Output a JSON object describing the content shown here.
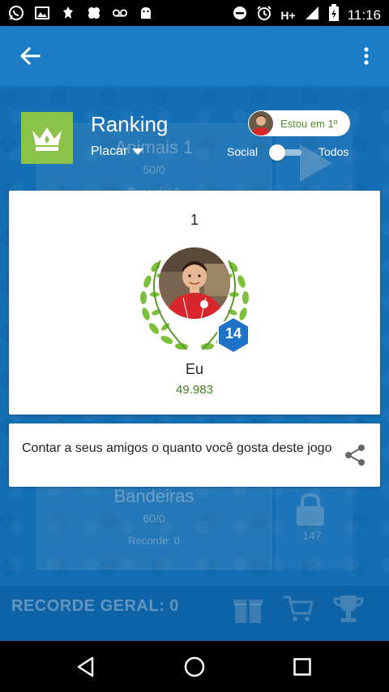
{
  "status_bar": {
    "left_icons": [
      "whatsapp-icon",
      "gallery-icon",
      "app-icon",
      "clover-icon",
      "voicemail-icon",
      "android-icon"
    ],
    "network": "H+",
    "time": "11:16"
  },
  "app_bar": {
    "back_icon": "arrow-back-icon",
    "menu_icon": "more-vert-icon"
  },
  "background": {
    "card1_title": "Animais 1",
    "card1_score": "50/0",
    "card1_record": "Recorde: 0",
    "card2_title": "Bandeiras",
    "card2_score": "60/0",
    "card2_record": "Recorde: 0",
    "locked_count": "147",
    "footer_record": "RECORDE GERAL: 0"
  },
  "header": {
    "title": "Ranking",
    "scope": "Placar",
    "rank_pill": "Estou em 1º",
    "toggle_left": "Social",
    "toggle_right": "Todos"
  },
  "ranking": {
    "position": "1",
    "level": "14",
    "name": "Eu",
    "score": "49.983"
  },
  "share": {
    "text": "Contar a seus amigos o quanto você gosta deste jogo"
  },
  "colors": {
    "app_bar": "#1a7cc5",
    "crown_bg": "#8bc34a",
    "score_green": "#3e7f22",
    "level_badge": "#1e72c8"
  }
}
